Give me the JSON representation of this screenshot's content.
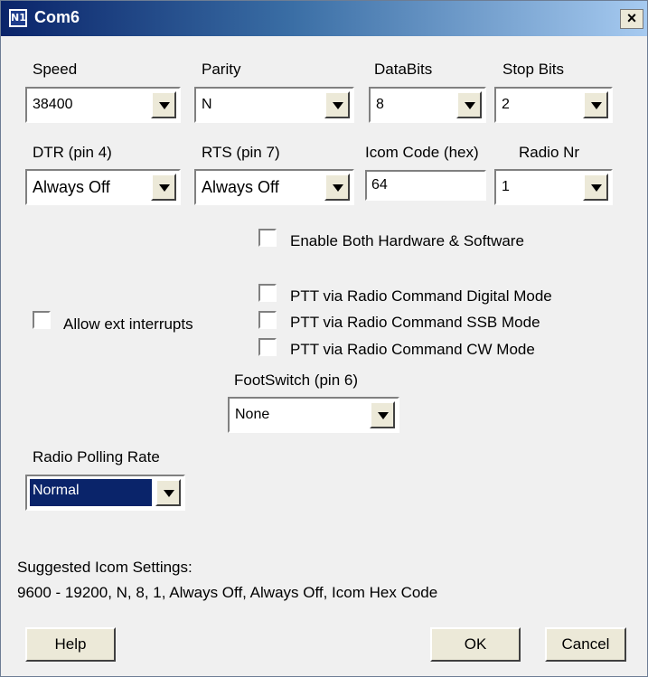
{
  "window": {
    "title": "Com6",
    "icon": "n1mm-logo-icon",
    "icon_text": "N1",
    "close_label": "×"
  },
  "fields": {
    "speed": {
      "label": "Speed",
      "value": "38400"
    },
    "parity": {
      "label": "Parity",
      "value": "N"
    },
    "databits": {
      "label": "DataBits",
      "value": "8"
    },
    "stopbits": {
      "label": "Stop Bits",
      "value": "2"
    },
    "dtr": {
      "label": "DTR (pin 4)",
      "value": "Always Off"
    },
    "rts": {
      "label": "RTS (pin 7)",
      "value": "Always Off"
    },
    "icom_code": {
      "label": "Icom Code (hex)",
      "value": "64"
    },
    "radio_nr": {
      "label": "Radio Nr",
      "value": "1"
    },
    "footswitch": {
      "label": "FootSwitch (pin 6)",
      "value": "None"
    },
    "polling": {
      "label": "Radio Polling Rate",
      "value": "Normal"
    }
  },
  "checkboxes": {
    "enable_both": {
      "label": "Enable Both Hardware & Software",
      "checked": false
    },
    "ptt_digital": {
      "label": "PTT via Radio Command Digital Mode",
      "checked": false
    },
    "ptt_ssb": {
      "label": "PTT via Radio Command SSB Mode",
      "checked": false
    },
    "ptt_cw": {
      "label": "PTT via Radio Command CW Mode",
      "checked": false
    },
    "allow_ext": {
      "label": "Allow ext interrupts",
      "checked": false
    }
  },
  "suggestion": {
    "heading": "Suggested Icom Settings:",
    "text": "9600 - 19200,  N,  8,  1,  Always Off, Always Off,  Icom Hex Code"
  },
  "buttons": {
    "help": "Help",
    "ok": "OK",
    "cancel": "Cancel"
  }
}
